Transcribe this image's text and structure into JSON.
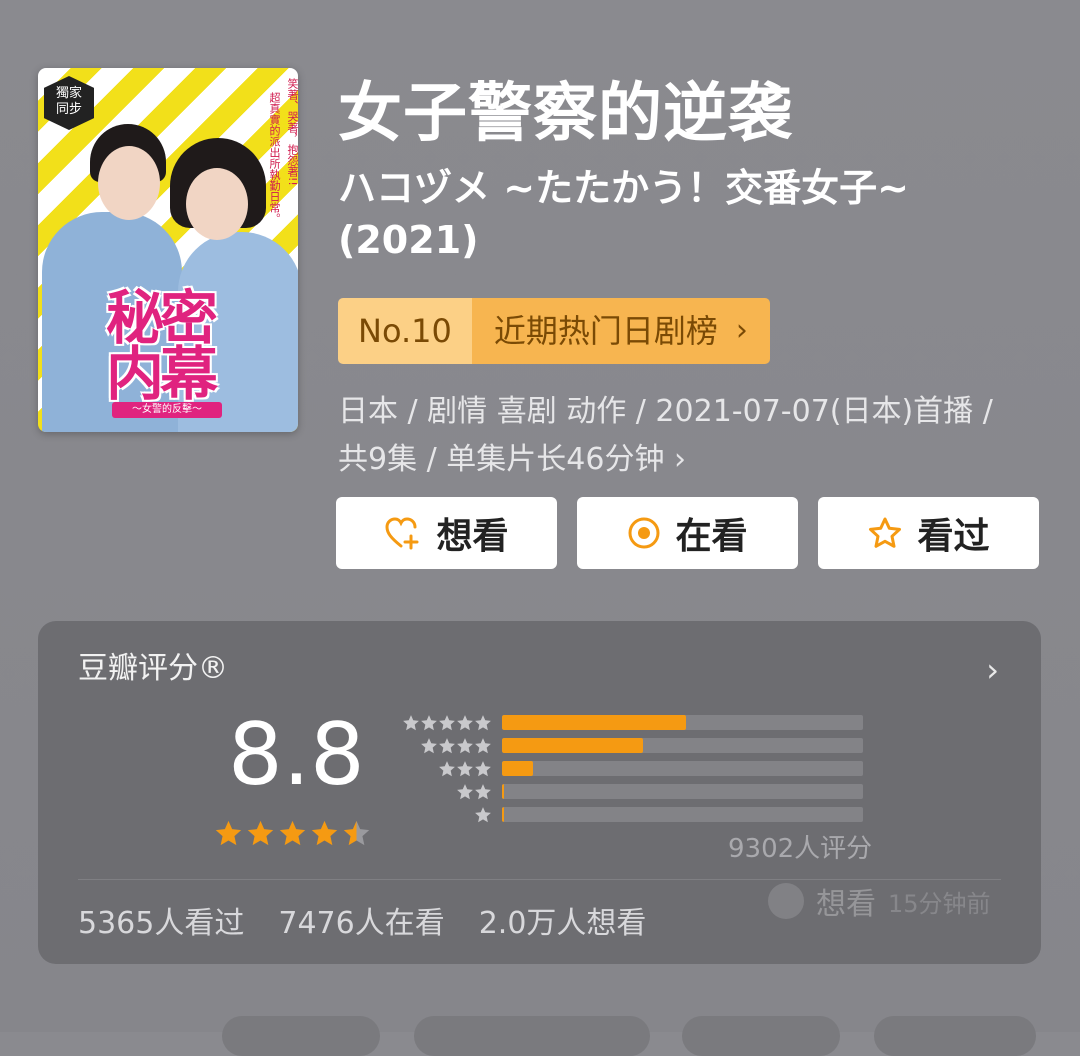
{
  "poster": {
    "badge": "獨家\n同步",
    "side_text_1": "笑著、哭著，抱怨著!!",
    "side_text_2": "超真實的派出所執勤日常。",
    "logo_text": "秘密内幕",
    "logo_sub": "〜女警的反擊〜"
  },
  "title": "女子警察的逆袭",
  "subtitle": "ハコヅメ ~たたかう！交番女子~ (2021)",
  "rank": {
    "number": "No.10",
    "label": "近期热门日剧榜",
    "chevron": "›"
  },
  "meta": {
    "line1": "日本 / 剧情 喜剧 动作 / 2021-07-07(日本)首播 /",
    "line2": "共9集 / 单集片长46分钟 ›"
  },
  "actions": {
    "want": "想看",
    "watching": "在看",
    "watched": "看过"
  },
  "rating": {
    "title": "豆瓣评分®",
    "chevron": "›",
    "score": "8.8",
    "stars": 4.5,
    "count": "9302人评分",
    "distribution": [
      {
        "stars": 5,
        "fraction": 0.51
      },
      {
        "stars": 4,
        "fraction": 0.39
      },
      {
        "stars": 3,
        "fraction": 0.085
      },
      {
        "stars": 2,
        "fraction": 0.005
      },
      {
        "stars": 1,
        "fraction": 0.005
      }
    ],
    "stats": {
      "watched": "5365人看过",
      "watching": "7476人在看",
      "want": "2.0万人想看"
    },
    "ghost_activity": {
      "action": "想看",
      "time": "15分钟前"
    }
  },
  "colors": {
    "accent": "#f59a12",
    "rank_left": "#fcd086",
    "rank_right": "#f7b550",
    "background": "#8a8a8f",
    "card": "#6d6d71"
  }
}
